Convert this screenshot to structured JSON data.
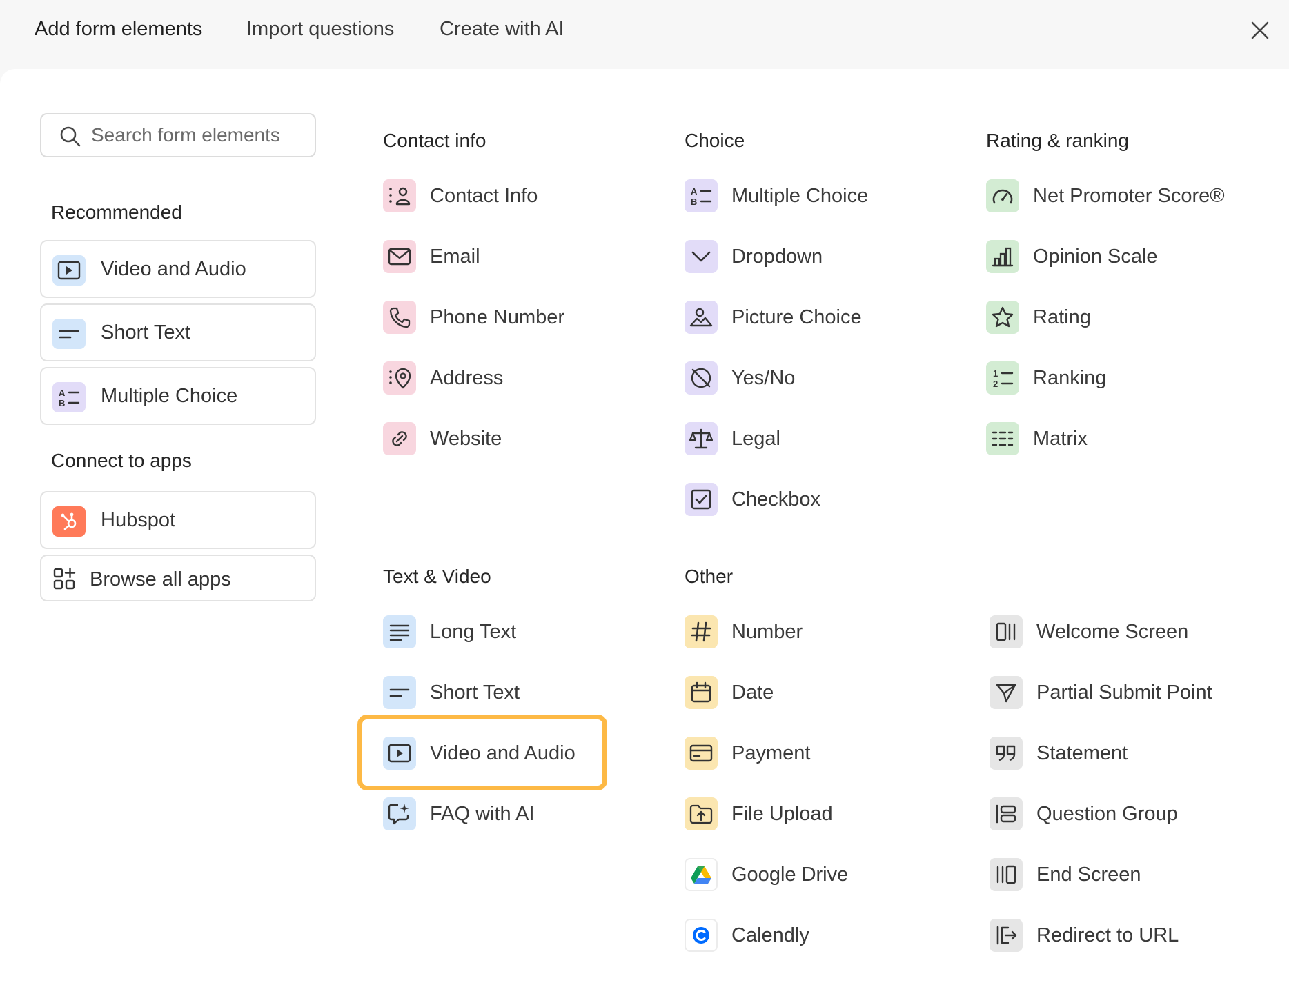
{
  "tabs": [
    {
      "label": "Add form elements"
    },
    {
      "label": "Import questions"
    },
    {
      "label": "Create with AI"
    }
  ],
  "search": {
    "placeholder": "Search form elements"
  },
  "sidebar": {
    "recommended_heading": "Recommended",
    "recommended": [
      {
        "label": "Video and Audio",
        "icon": "play-icon"
      },
      {
        "label": "Short Text",
        "icon": "short-text-icon"
      },
      {
        "label": "Multiple Choice",
        "icon": "multiple-choice-icon"
      }
    ],
    "connect_heading": "Connect to apps",
    "apps": [
      {
        "label": "Hubspot",
        "icon": "hubspot-icon"
      },
      {
        "label": "Browse all apps",
        "icon": "apps-grid-icon"
      }
    ]
  },
  "sections": {
    "contact": {
      "heading": "Contact info",
      "items": [
        {
          "label": "Contact Info",
          "icon": "contact-icon"
        },
        {
          "label": "Email",
          "icon": "email-icon"
        },
        {
          "label": "Phone Number",
          "icon": "phone-icon"
        },
        {
          "label": "Address",
          "icon": "location-icon"
        },
        {
          "label": "Website",
          "icon": "link-icon"
        }
      ]
    },
    "choice": {
      "heading": "Choice",
      "items": [
        {
          "label": "Multiple Choice",
          "icon": "multiple-choice-icon"
        },
        {
          "label": "Dropdown",
          "icon": "chevron-down-icon"
        },
        {
          "label": "Picture Choice",
          "icon": "picture-icon"
        },
        {
          "label": "Yes/No",
          "icon": "yes-no-icon"
        },
        {
          "label": "Legal",
          "icon": "scale-icon"
        },
        {
          "label": "Checkbox",
          "icon": "checkbox-icon"
        }
      ]
    },
    "rating": {
      "heading": "Rating & ranking",
      "items": [
        {
          "label": "Net Promoter Score®",
          "icon": "gauge-icon"
        },
        {
          "label": "Opinion Scale",
          "icon": "bar-chart-icon"
        },
        {
          "label": "Rating",
          "icon": "star-icon"
        },
        {
          "label": "Ranking",
          "icon": "numbered-list-icon"
        },
        {
          "label": "Matrix",
          "icon": "grid-icon"
        }
      ]
    },
    "text_video": {
      "heading": "Text & Video",
      "items": [
        {
          "label": "Long Text",
          "icon": "long-text-icon"
        },
        {
          "label": "Short Text",
          "icon": "short-text-icon"
        },
        {
          "label": "Video and Audio",
          "icon": "play-icon"
        },
        {
          "label": "FAQ with AI",
          "icon": "ai-chat-icon"
        }
      ]
    },
    "other": {
      "heading": "Other",
      "items": [
        {
          "label": "Number",
          "icon": "hash-icon"
        },
        {
          "label": "Date",
          "icon": "calendar-icon"
        },
        {
          "label": "Payment",
          "icon": "credit-card-icon"
        },
        {
          "label": "File Upload",
          "icon": "upload-icon"
        },
        {
          "label": "Google Drive",
          "icon": "google-drive-icon"
        },
        {
          "label": "Calendly",
          "icon": "calendly-icon"
        }
      ]
    },
    "screens": {
      "items": [
        {
          "label": "Welcome Screen",
          "icon": "welcome-screen-icon"
        },
        {
          "label": "Partial Submit Point",
          "icon": "send-icon"
        },
        {
          "label": "Statement",
          "icon": "quote-icon"
        },
        {
          "label": "Question Group",
          "icon": "group-icon"
        },
        {
          "label": "End Screen",
          "icon": "end-screen-icon"
        },
        {
          "label": "Redirect to URL",
          "icon": "redirect-icon"
        }
      ]
    }
  },
  "colors": {
    "highlight": "#fdb945",
    "pink": "#f8d6df",
    "purple": "#e2dcf8",
    "green": "#d3ecd3",
    "blue": "#d3e6fa",
    "yellow": "#fbe6b0",
    "gray": "#e6e6e6",
    "hubspot": "#ff7a59"
  }
}
